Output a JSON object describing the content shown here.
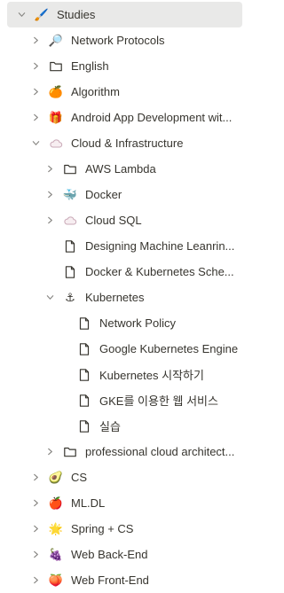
{
  "tree": [
    {
      "label": "Studies",
      "icon": "brush-icon",
      "glyph": "🖌️",
      "level": 0,
      "expand": "down",
      "selected": true
    },
    {
      "label": "Network Protocols",
      "icon": "magnifier-icon",
      "glyph": "🔎",
      "level": 1,
      "expand": "right"
    },
    {
      "label": "English",
      "icon": "folder-icon",
      "level": 1,
      "expand": "right"
    },
    {
      "label": "Algorithm",
      "icon": "tangerine-icon",
      "glyph": "🍊",
      "level": 1,
      "expand": "right"
    },
    {
      "label": "Android App Development wit...",
      "icon": "gift-icon",
      "glyph": "🎁",
      "level": 1,
      "expand": "right"
    },
    {
      "label": "Cloud & Infrastructure",
      "icon": "cloud-icon",
      "level": 1,
      "expand": "down"
    },
    {
      "label": "AWS Lambda",
      "icon": "folder-icon",
      "level": 2,
      "expand": "right"
    },
    {
      "label": "Docker",
      "icon": "docker-icon",
      "glyph": "🐳",
      "level": 2,
      "expand": "right"
    },
    {
      "label": "Cloud SQL",
      "icon": "cloud-icon",
      "level": 2,
      "expand": "right"
    },
    {
      "label": "Designing Machine Leanrin...",
      "icon": "page-icon",
      "level": 2,
      "expand": "none"
    },
    {
      "label": "Docker & Kubernetes Sche...",
      "icon": "page-icon",
      "level": 2,
      "expand": "none"
    },
    {
      "label": "Kubernetes",
      "icon": "anchor-icon",
      "glyph": "⚓",
      "level": 2,
      "expand": "down"
    },
    {
      "label": "Network Policy",
      "icon": "page-icon",
      "level": 3,
      "expand": "none"
    },
    {
      "label": "Google Kubernetes Engine",
      "icon": "page-icon",
      "level": 3,
      "expand": "none"
    },
    {
      "label": "Kubernetes 시작하기",
      "icon": "page-icon",
      "level": 3,
      "expand": "none"
    },
    {
      "label": "GKE를 이용한 웹 서비스",
      "icon": "page-icon",
      "level": 3,
      "expand": "none"
    },
    {
      "label": "실습",
      "icon": "page-icon",
      "level": 3,
      "expand": "none"
    },
    {
      "label": "professional cloud architect...",
      "icon": "folder-icon",
      "level": 2,
      "expand": "right"
    },
    {
      "label": "CS",
      "icon": "avocado-icon",
      "glyph": "🥑",
      "level": 1,
      "expand": "right"
    },
    {
      "label": "ML.DL",
      "icon": "apple-icon",
      "glyph": "🍎",
      "level": 1,
      "expand": "right"
    },
    {
      "label": "Spring + CS",
      "icon": "star-icon",
      "glyph": "🌟",
      "level": 1,
      "expand": "right"
    },
    {
      "label": "Web Back-End",
      "icon": "grapes-icon",
      "glyph": "🍇",
      "level": 1,
      "expand": "right"
    },
    {
      "label": "Web Front-End",
      "icon": "peach-icon",
      "glyph": "🍑",
      "level": 1,
      "expand": "right"
    }
  ]
}
